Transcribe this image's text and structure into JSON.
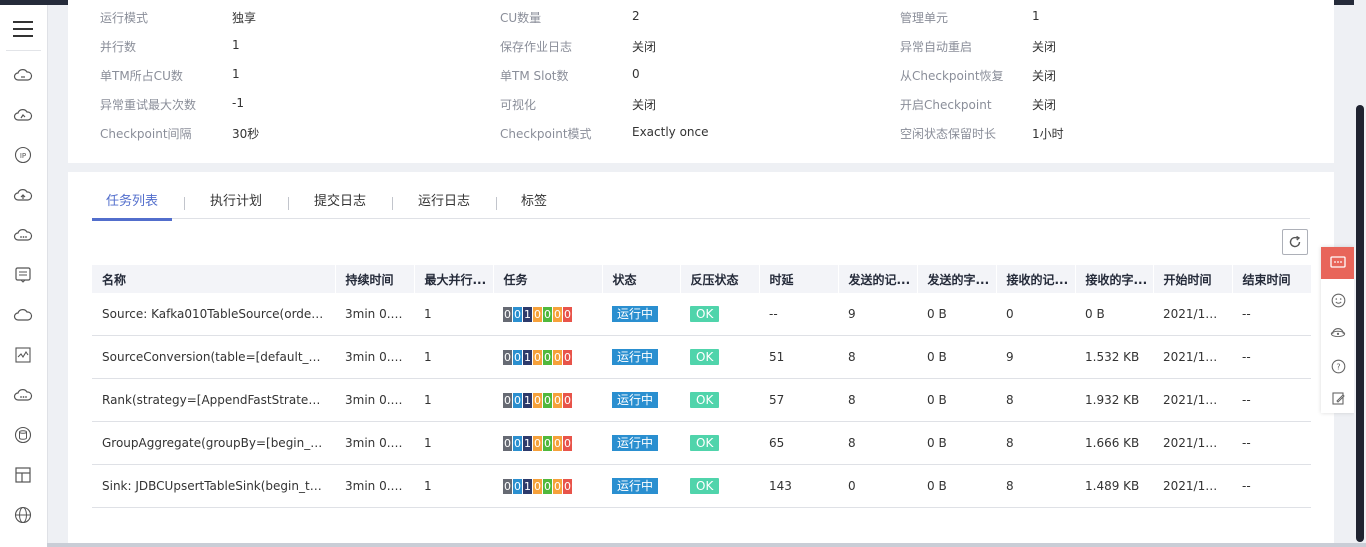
{
  "info": [
    [
      {
        "label": "运行模式",
        "value": "独享"
      },
      {
        "label": "CU数量",
        "value": "2"
      },
      {
        "label": "管理单元",
        "value": "1"
      }
    ],
    [
      {
        "label": "并行数",
        "value": "1"
      },
      {
        "label": "保存作业日志",
        "value": "关闭"
      },
      {
        "label": "异常自动重启",
        "value": "关闭"
      }
    ],
    [
      {
        "label": "单TM所占CU数",
        "value": "1"
      },
      {
        "label": "单TM Slot数",
        "value": "0"
      },
      {
        "label": "从Checkpoint恢复",
        "value": "关闭"
      }
    ],
    [
      {
        "label": "异常重试最大次数",
        "value": "-1"
      },
      {
        "label": "可视化",
        "value": "关闭"
      },
      {
        "label": "开启Checkpoint",
        "value": "关闭"
      }
    ],
    [
      {
        "label": "Checkpoint间隔",
        "value": "30秒"
      },
      {
        "label": "Checkpoint模式",
        "value": "Exactly once"
      },
      {
        "label": "空闲状态保留时长",
        "value": "1小时"
      }
    ]
  ],
  "tabs": [
    "任务列表",
    "执行计划",
    "提交日志",
    "运行日志",
    "标签"
  ],
  "table": {
    "headers": [
      "名称",
      "持续时间",
      "最大并行...",
      "任务",
      "状态",
      "反压状态",
      "时延",
      "发送的记...",
      "发送的字...",
      "接收的记...",
      "接收的字...",
      "开始时间",
      "结束时间"
    ],
    "task_counts": [
      "0",
      "0",
      "1",
      "0",
      "0",
      "0",
      "0"
    ],
    "task_colors": [
      "#666a73",
      "#2a8fd0",
      "#2d3a6b",
      "#f6a13a",
      "#50b83c",
      "#f6a13a",
      "#e8544a"
    ],
    "rows": [
      {
        "name": "Source: Kafka010TableSource(order_id,...",
        "duration": "3min 0.8...",
        "parallel": "1",
        "status": "运行中",
        "backpressure": "OK",
        "latency": "--",
        "sent_records": "9",
        "sent_bytes": "0 B",
        "recv_records": "0",
        "recv_bytes": "0 B",
        "start": "2021/12/...",
        "end": "--"
      },
      {
        "name": "SourceConversion(table=[default_catal...",
        "duration": "3min 0.8...",
        "parallel": "1",
        "status": "运行中",
        "backpressure": "OK",
        "latency": "51",
        "sent_records": "8",
        "sent_bytes": "0 B",
        "recv_records": "9",
        "recv_bytes": "1.532 KB",
        "start": "2021/12/...",
        "end": "--"
      },
      {
        "name": "Rank(strategy=[AppendFastStrategy], r...",
        "duration": "3min 0.8...",
        "parallel": "1",
        "status": "运行中",
        "backpressure": "OK",
        "latency": "57",
        "sent_records": "8",
        "sent_bytes": "0 B",
        "recv_records": "8",
        "recv_bytes": "1.932 KB",
        "start": "2021/12/...",
        "end": "--"
      },
      {
        "name": "GroupAggregate(groupBy=[begin_time,...",
        "duration": "3min 0.8...",
        "parallel": "1",
        "status": "运行中",
        "backpressure": "OK",
        "latency": "65",
        "sent_records": "8",
        "sent_bytes": "0 B",
        "recv_records": "8",
        "recv_bytes": "1.666 KB",
        "start": "2021/12/...",
        "end": "--"
      },
      {
        "name": "Sink: JDBCUpsertTableSink(begin_time,...",
        "duration": "3min 0.8...",
        "parallel": "1",
        "status": "运行中",
        "backpressure": "OK",
        "latency": "143",
        "sent_records": "0",
        "sent_bytes": "0 B",
        "recv_records": "8",
        "recv_bytes": "1.489 KB",
        "start": "2021/12/...",
        "end": "--"
      }
    ]
  },
  "nav_icons": [
    "menu-icon",
    "cloud-server-icon",
    "cloud-monitor-icon",
    "eip-icon",
    "cloud-upload-icon",
    "cloud-more-icon",
    "message-icon",
    "cloud-icon",
    "chart-icon",
    "cloud-dots-icon",
    "database-icon",
    "layout-icon",
    "globe-icon"
  ],
  "float_icons": [
    "feedback-icon",
    "smile-icon",
    "headset-icon",
    "help-icon",
    "edit-icon"
  ]
}
